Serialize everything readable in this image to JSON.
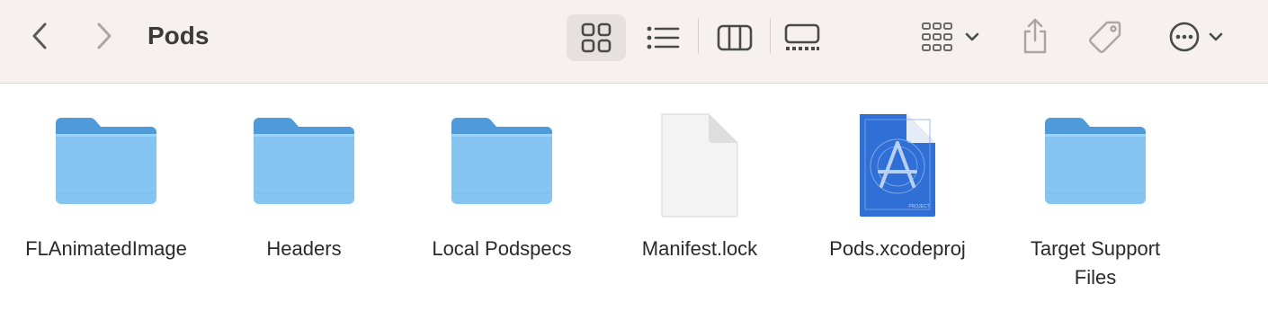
{
  "window": {
    "title": "Pods"
  },
  "toolbar": {
    "back_icon": "chevron-left-icon",
    "forward_icon": "chevron-right-icon",
    "view_modes": [
      {
        "name": "icon-view",
        "icon": "grid-icon",
        "selected": true
      },
      {
        "name": "list-view",
        "icon": "list-icon",
        "selected": false
      },
      {
        "name": "column-view",
        "icon": "columns-icon",
        "selected": false
      },
      {
        "name": "gallery-view",
        "icon": "gallery-icon",
        "selected": false
      }
    ],
    "group_icon": "group-grid-icon",
    "share_icon": "share-icon",
    "tag_icon": "tag-icon",
    "more_icon": "ellipsis-circle-icon"
  },
  "files": [
    {
      "label": "FLAnimatedImage",
      "kind": "folder"
    },
    {
      "label": "Headers",
      "kind": "folder"
    },
    {
      "label": "Local Podspecs",
      "kind": "folder"
    },
    {
      "label": "Manifest.lock",
      "kind": "document"
    },
    {
      "label": "Pods.xcodeproj",
      "kind": "xcodeproj",
      "badge": "PROJECT"
    },
    {
      "label": "Target Support Files",
      "kind": "folder"
    }
  ],
  "colors": {
    "toolbar_bg": "#f6f0f0",
    "folder_back": "#4f9ad9",
    "folder_front": "#86c5f2",
    "xcode_blue": "#2f6fd6"
  }
}
